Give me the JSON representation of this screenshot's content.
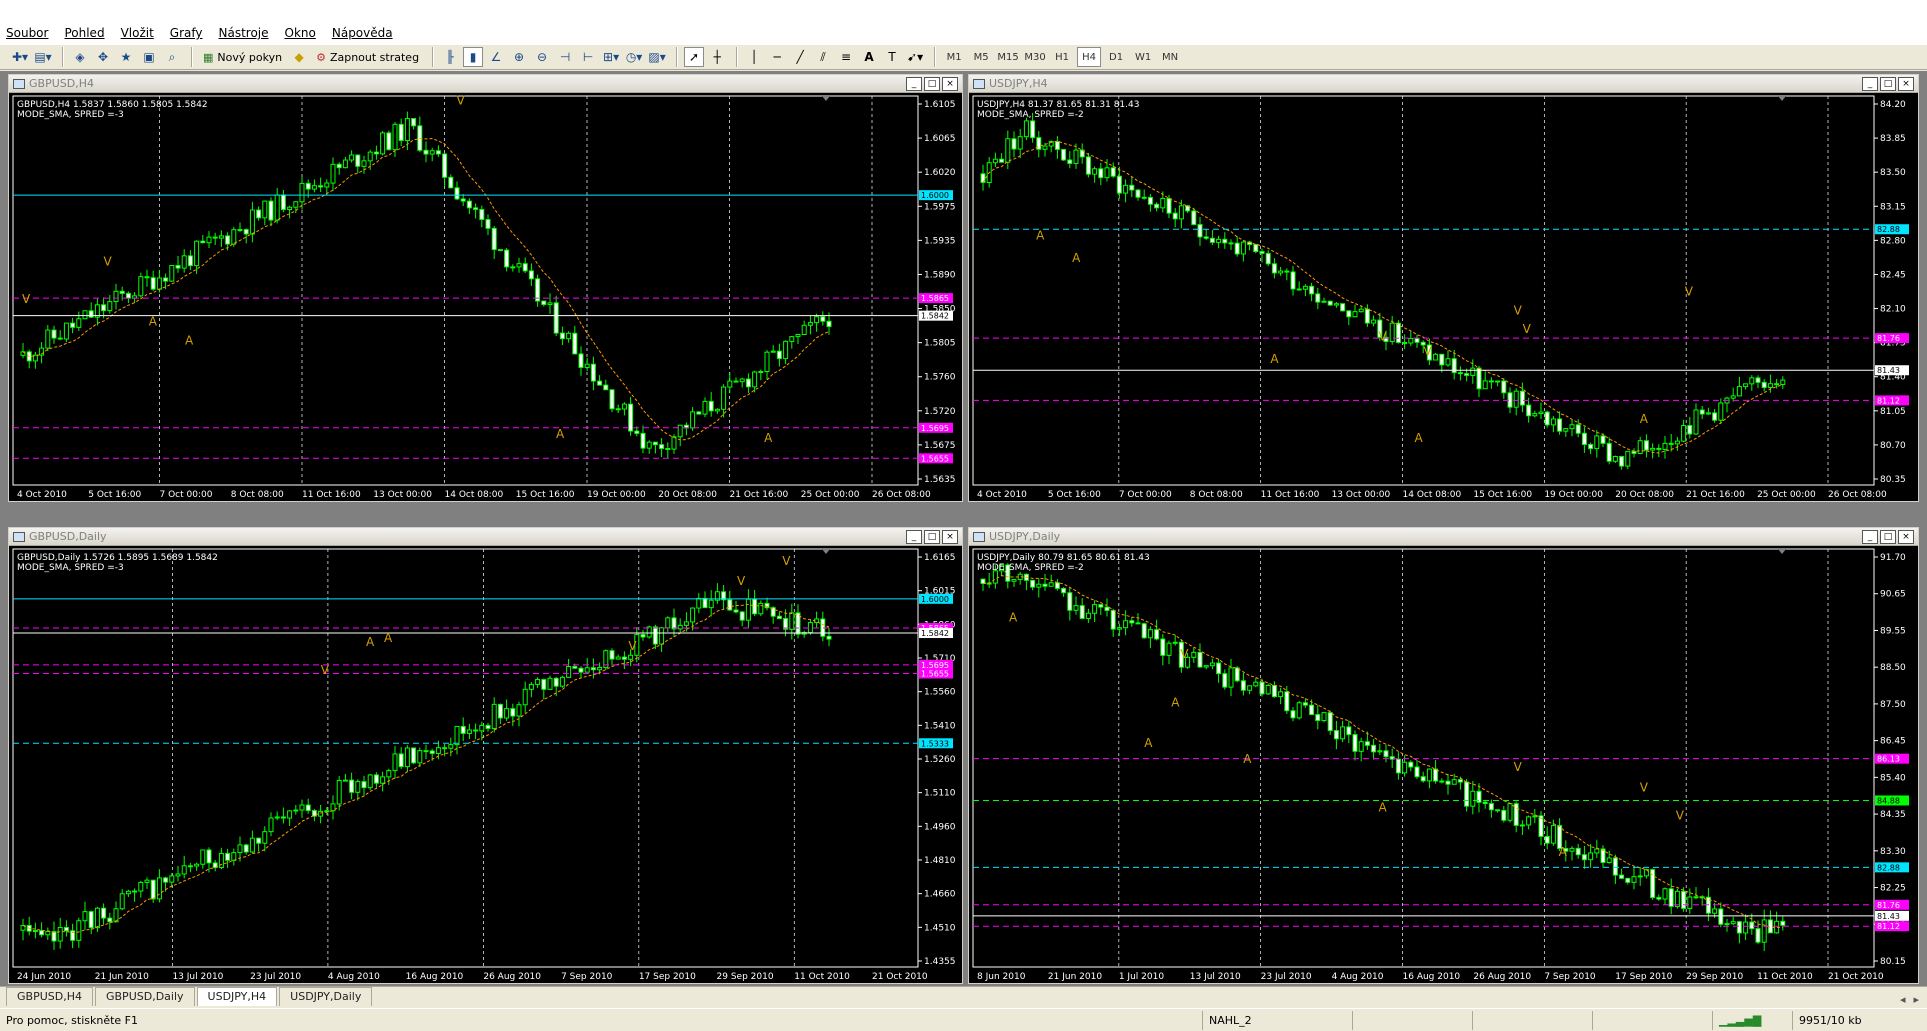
{
  "menu": [
    "Soubor",
    "Pohled",
    "Vložit",
    "Grafy",
    "Nástroje",
    "Okno",
    "Nápověda"
  ],
  "toolbar": {
    "new_order_label": "Nový pokyn",
    "autotrade_label": "Zapnout strateg",
    "timeframes": [
      "M1",
      "M5",
      "M15",
      "M30",
      "H1",
      "H4",
      "D1",
      "W1",
      "MN"
    ],
    "active_timeframe": "H4",
    "icons": [
      "new-chart-icon",
      "profiles-icon",
      "market-watch-icon",
      "navigator-icon",
      "terminal-icon",
      "data-window-icon",
      "tester-icon",
      "new-order-icon",
      "expert-icon",
      "autotrade-icon",
      "bar-chart-icon",
      "candle-chart-icon",
      "line-chart-icon",
      "zoom-in-icon",
      "zoom-out-icon",
      "autoscroll-icon",
      "chart-shift-icon",
      "indicators-icon",
      "periods-icon",
      "templates-icon",
      "cursor-icon",
      "crosshair-icon",
      "vertical-line-icon",
      "horizontal-line-icon",
      "trendline-icon",
      "channel-icon",
      "fibonacci-icon",
      "text-icon",
      "text-label-icon",
      "arrows-icon"
    ]
  },
  "windows": [
    {
      "title": "GBPUSD,H4",
      "info": [
        "GBPUSD,H4  1.5837 1.5860 1.5805 1.5842",
        "MODE_SMA, SPRED =-3"
      ],
      "price_ticks": [
        "1.6105",
        "1.6065",
        "1.6020",
        "1.5975",
        "1.5935",
        "1.5890",
        "1.5850",
        "1.5805",
        "1.5760",
        "1.5720",
        "1.5675",
        "1.5635"
      ],
      "ymin": 1.562,
      "ymax": 1.613,
      "time_ticks": [
        "4 Oct 2010",
        "5 Oct 16:00",
        "7 Oct 00:00",
        "8 Oct 08:00",
        "11 Oct 16:00",
        "13 Oct 00:00",
        "14 Oct 08:00",
        "15 Oct 16:00",
        "19 Oct 00:00",
        "20 Oct 08:00",
        "21 Oct 16:00",
        "25 Oct 00:00",
        "26 Oct 08:00"
      ],
      "price_badges": [
        {
          "text": "1.6000",
          "value": 1.6,
          "color": "#00e5ff",
          "style": "solid"
        },
        {
          "text": "1.5865",
          "value": 1.5865,
          "color": "#ff00ff",
          "style": "dash"
        },
        {
          "text": "1.5842",
          "value": 1.5842,
          "color": "#ffffff",
          "style": "solid"
        },
        {
          "text": "1.5695",
          "value": 1.5695,
          "color": "#ff00ff",
          "style": "dash"
        },
        {
          "text": "1.5655",
          "value": 1.5655,
          "color": "#ff00ff",
          "style": "dash"
        }
      ],
      "marks": [
        [
          "V",
          0.01,
          0.52
        ],
        [
          "A",
          0.15,
          0.58
        ],
        [
          "V",
          0.1,
          0.42
        ],
        [
          "A",
          0.19,
          0.63
        ],
        [
          "V",
          0.49,
          -0.01
        ],
        [
          "A",
          0.6,
          0.88
        ],
        [
          "A",
          0.83,
          0.89
        ]
      ],
      "path_start": 1.579,
      "path_end": 1.5842,
      "path_peak": [
        0.48,
        1.609
      ],
      "path_low": [
        0.78,
        1.5665
      ],
      "seed": 11
    },
    {
      "title": "USDJPY,H4",
      "info": [
        "USDJPY,H4  81.37 81.65 81.31 81.43",
        "MODE_SMA, SPRED =-2"
      ],
      "price_ticks": [
        "84.20",
        "83.85",
        "83.50",
        "83.15",
        "82.80",
        "82.45",
        "82.10",
        "81.75",
        "81.40",
        "81.05",
        "80.70",
        "80.35"
      ],
      "ymin": 80.25,
      "ymax": 84.25,
      "time_ticks": [
        "4 Oct 2010",
        "5 Oct 16:00",
        "7 Oct 00:00",
        "8 Oct 08:00",
        "11 Oct 16:00",
        "13 Oct 00:00",
        "14 Oct 08:00",
        "15 Oct 16:00",
        "19 Oct 00:00",
        "20 Oct 08:00",
        "21 Oct 16:00",
        "25 Oct 00:00",
        "26 Oct 08:00"
      ],
      "price_badges": [
        {
          "text": "82.88",
          "value": 82.88,
          "color": "#00e5ff",
          "style": "dash"
        },
        {
          "text": "81.76",
          "value": 81.76,
          "color": "#ff00ff",
          "style": "dash"
        },
        {
          "text": "81.43",
          "value": 81.43,
          "color": "#ffffff",
          "style": "solid"
        },
        {
          "text": "81.12",
          "value": 81.12,
          "color": "#ff00ff",
          "style": "dash"
        }
      ],
      "marks": [
        [
          "A",
          0.07,
          0.35
        ],
        [
          "A",
          0.11,
          0.41
        ],
        [
          "A",
          0.33,
          0.68
        ],
        [
          "V",
          0.45,
          0.62
        ],
        [
          "A",
          0.49,
          0.89
        ],
        [
          "V",
          0.5,
          0.66
        ],
        [
          "V",
          0.61,
          0.6
        ],
        [
          "V",
          0.6,
          0.55
        ],
        [
          "A",
          0.74,
          0.84
        ],
        [
          "V",
          0.79,
          0.5
        ]
      ],
      "path_start": 83.45,
      "path_end": 81.43,
      "path_peak": [
        0.05,
        83.9
      ],
      "path_low": [
        0.8,
        80.5
      ],
      "seed": 23
    },
    {
      "title": "GBPUSD,Daily",
      "info": [
        "GBPUSD,Daily  1.5726 1.5895 1.5689 1.5842",
        "MODE_SMA, SPRED =-3"
      ],
      "price_ticks": [
        "1.6165",
        "1.6015",
        "1.5860",
        "1.5710",
        "1.5560",
        "1.5410",
        "1.5260",
        "1.5110",
        "1.4960",
        "1.4810",
        "1.4660",
        "1.4510",
        "1.4355"
      ],
      "ymin": 1.43,
      "ymax": 1.623,
      "time_ticks": [
        "24 Jun 2010",
        "21 Jun 2010",
        "13 Jul 2010",
        "23 Jul 2010",
        "4 Aug 2010",
        "16 Aug 2010",
        "26 Aug 2010",
        "7 Sep 2010",
        "17 Sep 2010",
        "29 Sep 2010",
        "11 Oct 2010",
        "21 Oct 2010"
      ],
      "price_badges": [
        {
          "text": "1.6000",
          "value": 1.6,
          "color": "#00e5ff",
          "style": "solid"
        },
        {
          "text": "1.5865",
          "value": 1.5865,
          "color": "#ff00ff",
          "style": "dash"
        },
        {
          "text": "1.5842",
          "value": 1.5842,
          "color": "#ffffff",
          "style": "solid"
        },
        {
          "text": "1.5695",
          "value": 1.5695,
          "color": "#ff00ff",
          "style": "dash"
        },
        {
          "text": "1.5655",
          "value": 1.5655,
          "color": "#ff00ff",
          "style": "dash"
        },
        {
          "text": "1.5333",
          "value": 1.5333,
          "color": "#00e5ff",
          "style": "dash"
        }
      ],
      "marks": [
        [
          "V",
          0.34,
          0.28
        ],
        [
          "A",
          0.39,
          0.21
        ],
        [
          "A",
          0.41,
          0.2
        ],
        [
          "V",
          0.68,
          0.22
        ],
        [
          "V",
          0.8,
          0.06
        ],
        [
          "V",
          0.85,
          0.01
        ]
      ],
      "path_start": 1.447,
      "path_end": 1.5842,
      "path_peak": [
        0.86,
        1.599
      ],
      "path_low": [
        0.02,
        1.44
      ],
      "seed": 37
    },
    {
      "title": "USDJPY,Daily",
      "info": [
        "USDJPY,Daily  80.79 81.65 80.61 81.43",
        "MODE_SMA, SPRED =-2"
      ],
      "price_ticks": [
        "91.70",
        "90.65",
        "89.55",
        "88.50",
        "87.50",
        "86.45",
        "85.40",
        "84.35",
        "83.30",
        "82.25",
        "81.20",
        "80.15"
      ],
      "ymin": 79.9,
      "ymax": 92.4,
      "time_ticks": [
        "8 Jun 2010",
        "21 Jun 2010",
        "1 Jul 2010",
        "13 Jul 2010",
        "23 Jul 2010",
        "4 Aug 2010",
        "16 Aug 2010",
        "26 Aug 2010",
        "7 Sep 2010",
        "17 Sep 2010",
        "29 Sep 2010",
        "11 Oct 2010",
        "21 Oct 2010"
      ],
      "price_badges": [
        {
          "text": "86.13",
          "value": 86.13,
          "color": "#ff00ff",
          "style": "dash"
        },
        {
          "text": "84.88",
          "value": 84.88,
          "color": "#00ff00",
          "style": "dash"
        },
        {
          "text": "82.88",
          "value": 82.88,
          "color": "#00e5ff",
          "style": "dash"
        },
        {
          "text": "81.76",
          "value": 81.76,
          "color": "#ff00ff",
          "style": "dash"
        },
        {
          "text": "81.43",
          "value": 81.43,
          "color": "#ffffff",
          "style": "solid"
        },
        {
          "text": "81.12",
          "value": 81.12,
          "color": "#ff00ff",
          "style": "dash"
        }
      ],
      "marks": [
        [
          "A",
          0.04,
          0.15
        ],
        [
          "V",
          0.23,
          0.24
        ],
        [
          "A",
          0.22,
          0.36
        ],
        [
          "A",
          0.19,
          0.46
        ],
        [
          "A",
          0.3,
          0.5
        ],
        [
          "A",
          0.45,
          0.62
        ],
        [
          "V",
          0.6,
          0.52
        ],
        [
          "A",
          0.65,
          0.73
        ],
        [
          "V",
          0.74,
          0.57
        ],
        [
          "V",
          0.78,
          0.64
        ]
      ],
      "path_start": 91.5,
      "path_end": 81.43,
      "path_peak": [
        0.02,
        91.9
      ],
      "path_low": [
        0.97,
        80.8
      ],
      "seed": 53
    }
  ],
  "tabs": [
    "GBPUSD,H4",
    "GBPUSD,Daily",
    "USDJPY,H4",
    "USDJPY,Daily"
  ],
  "active_tab": "USDJPY,H4",
  "status": {
    "help": "Pro pomoc, stiskněte F1",
    "profile": "NAHL_2",
    "traffic": "9951/10 kb"
  }
}
